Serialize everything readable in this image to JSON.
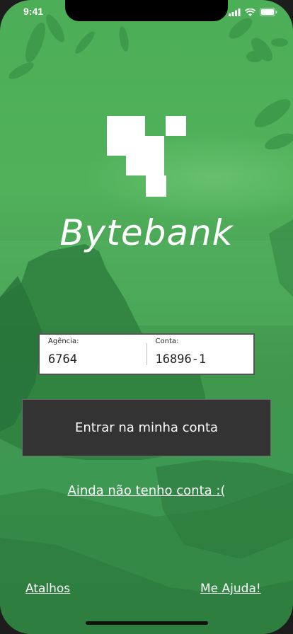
{
  "status_bar": {
    "time": "9:41",
    "icons": [
      "signal-icon",
      "wifi-icon",
      "battery-icon"
    ]
  },
  "brand": {
    "name": "Bytebank",
    "logo_icon": "bytebank-pixel-logo"
  },
  "login_form": {
    "agency": {
      "label": "Agência:",
      "value": "6764"
    },
    "account": {
      "label": "Conta:",
      "value": "16896-1"
    }
  },
  "actions": {
    "login_label": "Entrar na minha conta",
    "signup_label": "Ainda não tenho conta :(",
    "shortcuts_label": "Atalhos",
    "help_label": "Me Ajuda!"
  },
  "colors": {
    "background_green": "#4cae57",
    "button_dark": "#333333",
    "text_white": "#ffffff"
  }
}
